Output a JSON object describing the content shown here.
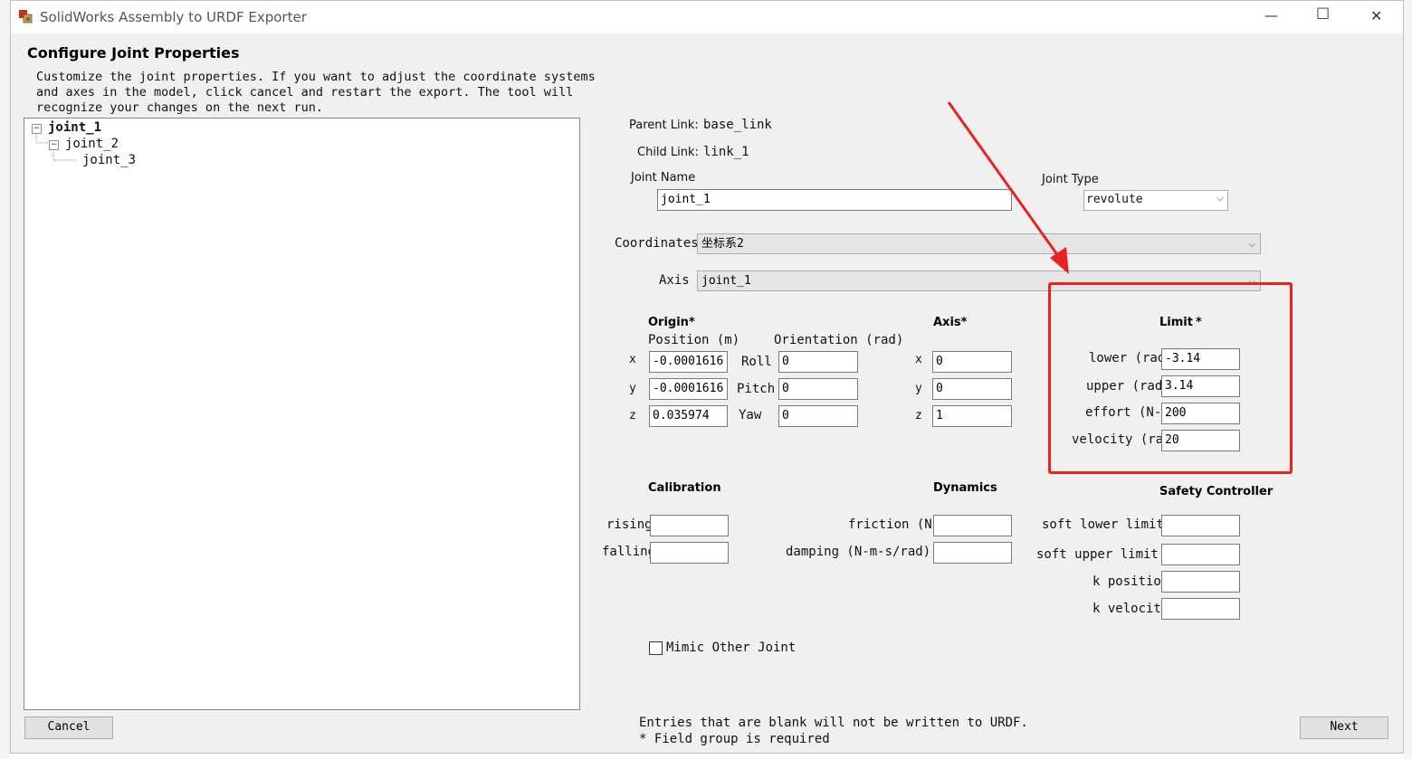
{
  "window": {
    "title": "SolidWorks Assembly to URDF Exporter",
    "minimize_glyph": "—",
    "maximize_glyph": "☐",
    "close_glyph": "✕"
  },
  "header": {
    "title": "Configure Joint Properties",
    "description": "Customize the joint properties. If you want to adjust the coordinate systems\nand axes in the model, click cancel and restart the export. The tool will\nrecognize your changes on the next run."
  },
  "tree": {
    "joint_1": "joint_1",
    "joint_2": "joint_2",
    "joint_3": "joint_3",
    "collapse_glyph": "−"
  },
  "links": {
    "parent_label": "Parent Link:",
    "parent_value": "base_link",
    "child_label": "Child Link:",
    "child_value": "link_1"
  },
  "joint": {
    "name_label": "Joint Name",
    "name_value": "joint_1",
    "type_label": "Joint Type",
    "type_value": "revolute"
  },
  "coordinates": {
    "label": "Coordinates",
    "value": "坐标系2"
  },
  "axis_select": {
    "label": "Axis",
    "value": "joint_1"
  },
  "origin": {
    "title": "Origin",
    "position_label": "Position (m)",
    "orientation_label": "Orientation (rad)",
    "x_label": "x",
    "y_label": "y",
    "z_label": "z",
    "x": "-0.0001616",
    "y": "-0.0001616",
    "z": "0.035974",
    "roll_label": "Roll",
    "pitch_label": "Pitch",
    "yaw_label": "Yaw",
    "roll": "0",
    "pitch": "0",
    "yaw": "0"
  },
  "axis": {
    "title": "Axis",
    "x_label": "x",
    "y_label": "y",
    "z_label": "z",
    "x": "0",
    "y": "0",
    "z": "1"
  },
  "limit": {
    "title": "Limit",
    "lower_label": "lower (rad)",
    "lower": "-3.14",
    "upper_label": "upper (rad)",
    "upper": "3.14",
    "effort_label": "effort (N-m)",
    "effort": "200",
    "velocity_label": "velocity (rad/s)",
    "velocity": "20"
  },
  "required_mark": "*",
  "calibration": {
    "title": "Calibration",
    "rising_label": "rising",
    "falling_label": "falling",
    "rising": "",
    "falling": ""
  },
  "dynamics": {
    "title": "Dynamics",
    "friction_label": "friction (N-m)",
    "damping_label": "damping (N-m-s/rad)",
    "friction": "",
    "damping": ""
  },
  "safety": {
    "title": "Safety Controller",
    "soft_lower_label": "soft lower limit",
    "soft_upper_label": "soft upper limit",
    "k_position_label": "k position",
    "k_velocity_label": "k velocity",
    "soft_lower": "",
    "soft_upper": "",
    "k_position": "",
    "k_velocity": ""
  },
  "mimic": {
    "label": "Mimic Other Joint",
    "checked": false
  },
  "footer": {
    "note1": "Entries that are blank will not be written to URDF.",
    "note2": "* Field group is required",
    "cancel": "Cancel",
    "next": "Next"
  },
  "annotation": {
    "color": "#e8231f"
  },
  "colors": {
    "titlebar": "#ffffff",
    "dialog": "#f0f0f0"
  }
}
